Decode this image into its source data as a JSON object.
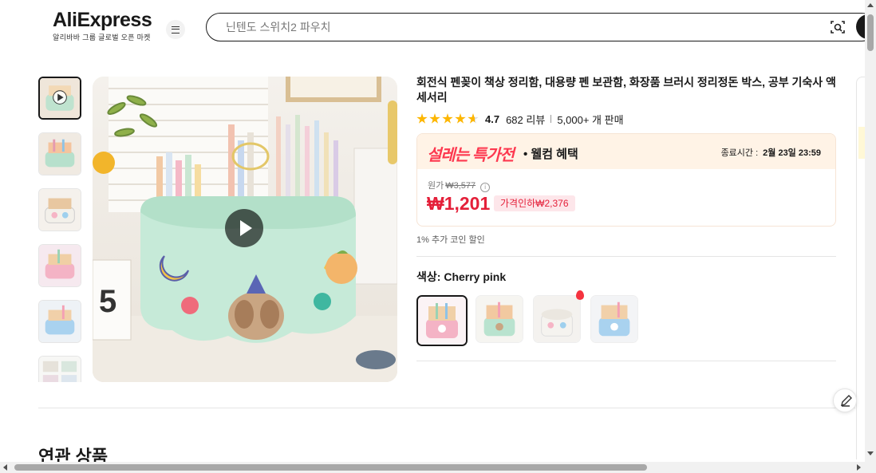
{
  "header": {
    "logo_text": "AliExpress",
    "logo_tagline": "알리바바 그룹 글로벌 오픈 마켓",
    "search_placeholder": "닌텐도 스위치2 파우치"
  },
  "product": {
    "title": "회전식 펜꽂이 책상 정리함, 대용량 펜 보관함, 화장품 브러시 정리정돈 박스, 공부 기숙사 액세서리",
    "rating": "4.7",
    "rating_stars": 4.7,
    "reviews": "682 리뷰",
    "sold": "5,000+ 개 판매"
  },
  "deal": {
    "name": "설레는 특가전",
    "name_suffix": "• 웰컴 혜택",
    "end_label": "종료시간 :",
    "end_time": "2월 23일 23:59",
    "original_label": "원가",
    "original_price": "₩3,577",
    "price": "₩1,201",
    "discount": "가격인하₩2,376",
    "coin_note": "1% 추가 코인 할인"
  },
  "color": {
    "label": "색상:",
    "selected": "Cherry pink",
    "options": [
      "Cherry pink",
      "Mint green",
      "White",
      "Blue"
    ]
  },
  "sections": {
    "related_title": "연관 상품"
  },
  "colors": {
    "brand_red": "#e4203a",
    "deal_red": "#fd384f",
    "star": "#fdb600",
    "deal_bg": "#fff3e6"
  }
}
